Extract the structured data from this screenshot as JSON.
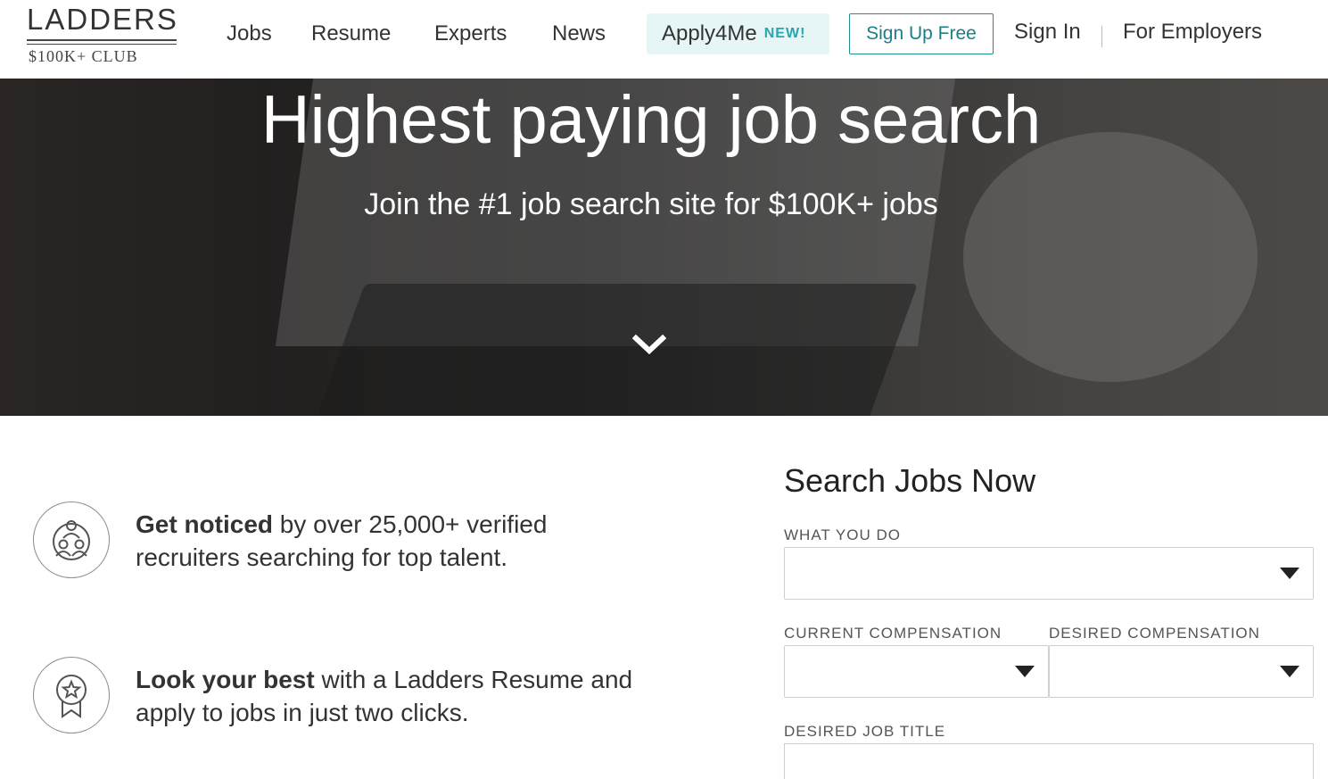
{
  "header": {
    "logo_top": "LADDERS",
    "logo_bottom": "$100K+ CLUB",
    "nav": [
      "Jobs",
      "Resume",
      "Experts",
      "News"
    ],
    "apply_label": "Apply4Me",
    "apply_badge": "NEW!",
    "signup_label": "Sign Up Free",
    "signin_label": "Sign In",
    "employers_label": "For Employers"
  },
  "hero": {
    "title": "Highest paying job search",
    "subtitle": "Join the #1 job search site for $100K+ jobs"
  },
  "features": [
    {
      "bold": "Get noticed",
      "rest": " by over 25,000+ verified recruiters searching for top talent.",
      "icon": "people-group-icon"
    },
    {
      "bold": "Look your best",
      "rest": " with a Ladders Resume and apply to jobs in just two clicks.",
      "icon": "award-ribbon-icon"
    }
  ],
  "search": {
    "title": "Search Jobs Now",
    "what_label": "WHAT YOU DO",
    "current_comp_label": "CURRENT COMPENSATION",
    "desired_comp_label": "DESIRED COMPENSATION",
    "job_title_label": "DESIRED JOB TITLE"
  },
  "colors": {
    "accent": "#1b8f96",
    "new_badge": "#2aa6ae",
    "apply_bg": "#e6f5f6"
  }
}
